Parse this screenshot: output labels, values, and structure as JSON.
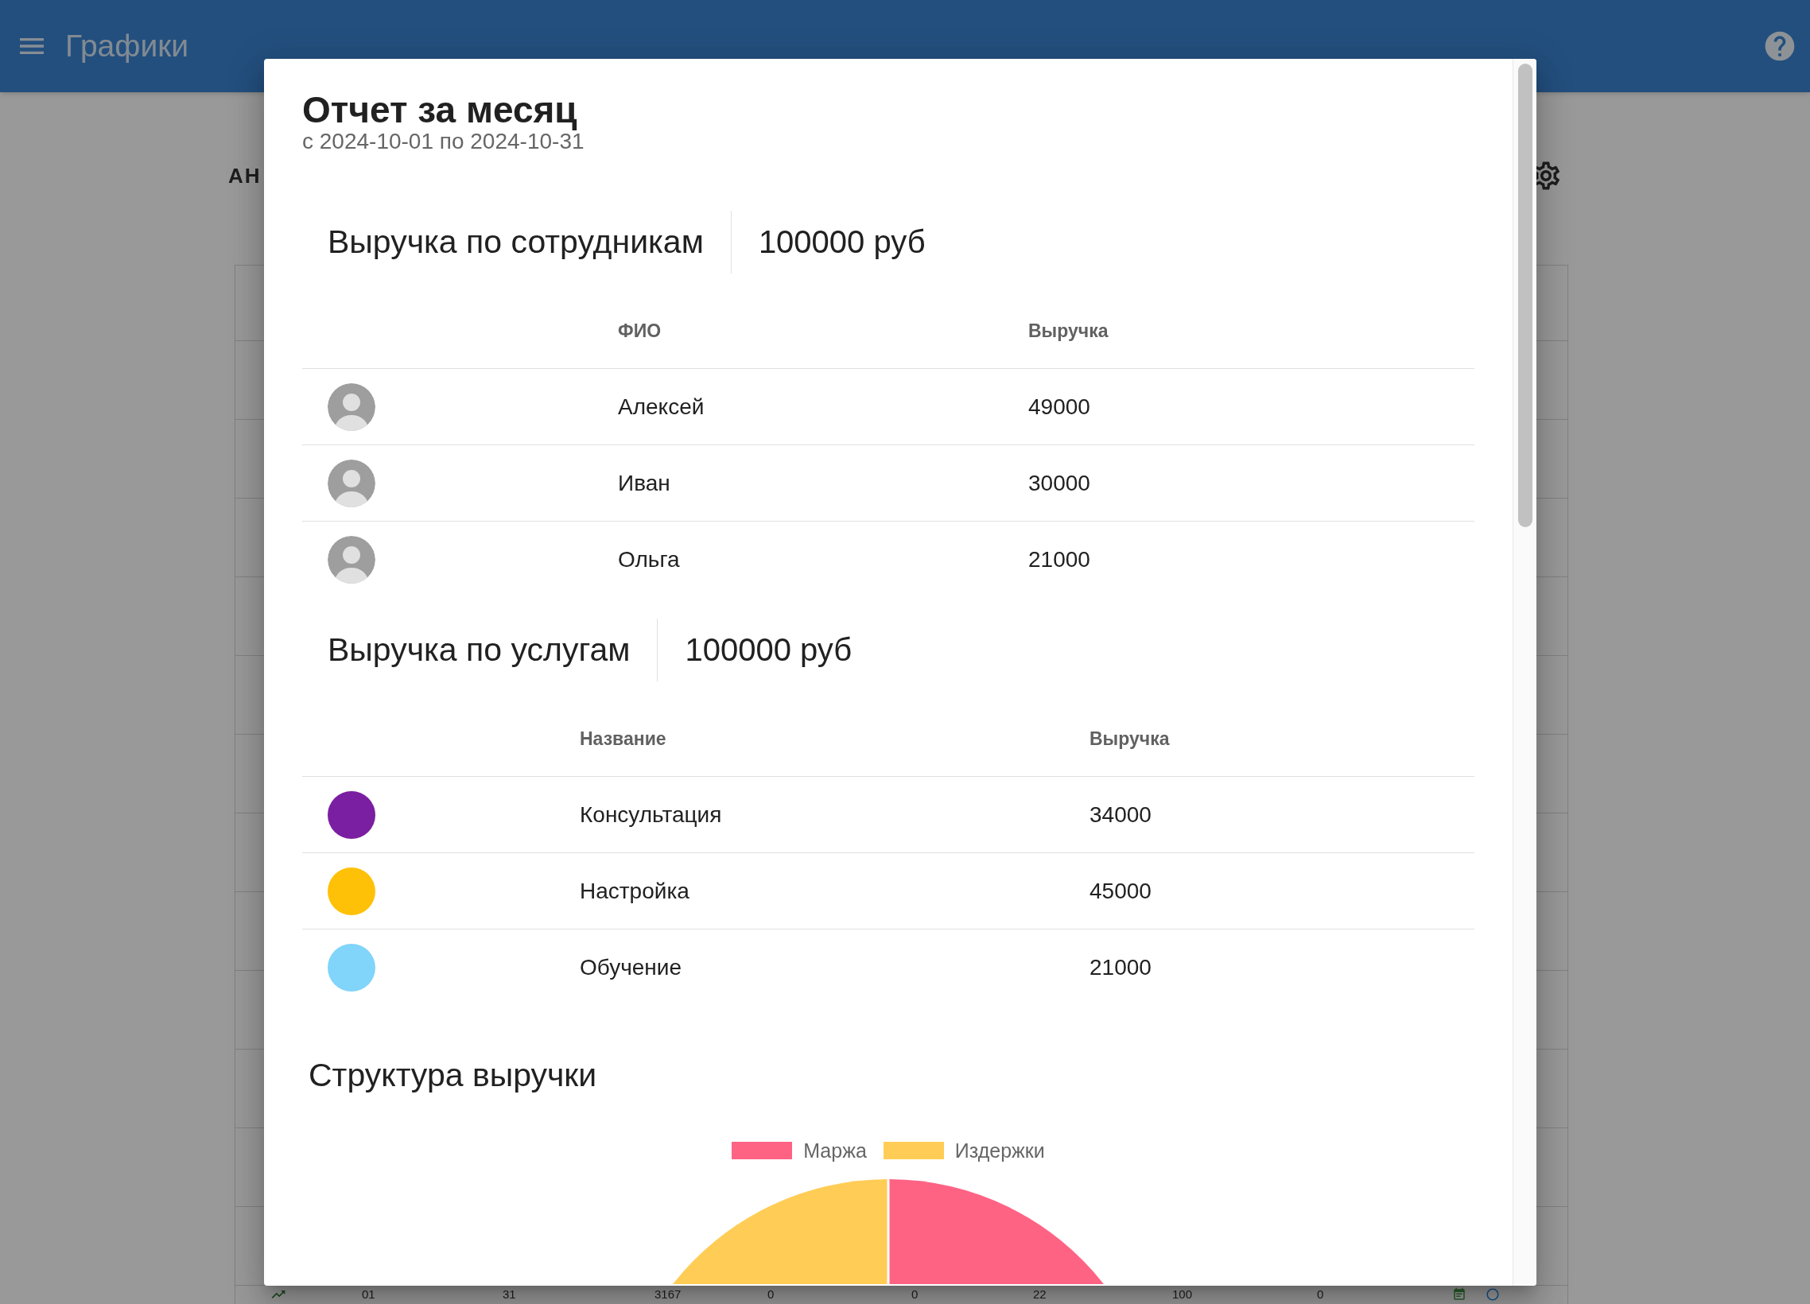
{
  "app_bar": {
    "title": "Графики"
  },
  "page": {
    "tab_label": "АН",
    "table_last_row": [
      "01",
      "31",
      "3167",
      "0",
      "0",
      "22",
      "100",
      "0"
    ]
  },
  "dialog": {
    "title": "Отчет за месяц",
    "subtitle": "с 2024-10-01 по 2024-10-31",
    "sections": [
      {
        "kind": "employees",
        "heading": "Выручка по сотрудникам",
        "total": "100000 руб",
        "columns": [
          "ФИО",
          "Выручка"
        ],
        "rows": [
          {
            "name": "Алексей",
            "revenue": "49000"
          },
          {
            "name": "Иван",
            "revenue": "30000"
          },
          {
            "name": "Ольга",
            "revenue": "21000"
          }
        ]
      },
      {
        "kind": "services",
        "heading": "Выручка по услугам",
        "total": "100000 руб",
        "columns": [
          "Название",
          "Выручка"
        ],
        "rows": [
          {
            "name": "Консультация",
            "revenue": "34000",
            "color": "#7b1fa2"
          },
          {
            "name": "Настройка",
            "revenue": "45000",
            "color": "#ffc107"
          },
          {
            "name": "Обучение",
            "revenue": "21000",
            "color": "#81d4fa"
          }
        ]
      }
    ],
    "chart": {
      "title": "Структура выручки",
      "legend": [
        {
          "label": "Маржа",
          "color": "#ff6384"
        },
        {
          "label": "Издержки",
          "color": "#ffcd56"
        }
      ]
    }
  }
}
